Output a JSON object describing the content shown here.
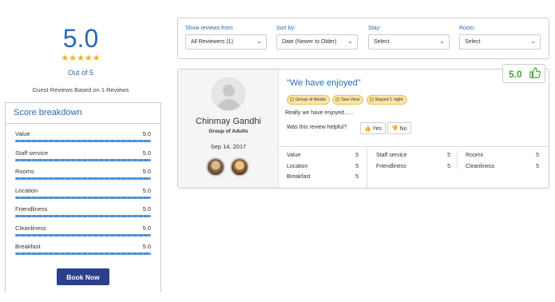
{
  "summary": {
    "score": "5.0",
    "stars": "★★★★★",
    "out_of": "Out of 5",
    "based_on": "Guest Reviews Based on 1 Reviews"
  },
  "breakdown": {
    "title": "Score breakdown",
    "rows": [
      {
        "label": "Value",
        "value": "5.0",
        "fraction": 1.0
      },
      {
        "label": "Staff service",
        "value": "5.0",
        "fraction": 1.0
      },
      {
        "label": "Rooms",
        "value": "5.0",
        "fraction": 1.0
      },
      {
        "label": "Location",
        "value": "5.0",
        "fraction": 1.0
      },
      {
        "label": "Friendliness",
        "value": "5.0",
        "fraction": 1.0
      },
      {
        "label": "Cleanliness",
        "value": "5.0",
        "fraction": 1.0
      },
      {
        "label": "Breakfast",
        "value": "5.0",
        "fraction": 1.0
      }
    ],
    "book_button": "Book Now"
  },
  "filters": {
    "show_from": {
      "label": "Show reviews from:",
      "value": "All Reviewers (1)"
    },
    "sort_by": {
      "label": "Sort by:",
      "value": "Date (Newer to Older)"
    },
    "stay": {
      "label": "Stay:",
      "value": "Select"
    },
    "room": {
      "label": "Room:",
      "value": "Select"
    }
  },
  "review": {
    "name": "Chinmay Gandhi",
    "group": "Group of Adults",
    "date": "Sep 14, 2017",
    "score": "5.0",
    "title": "\"We have enjoyed\"",
    "tags": [
      "Group of Adults",
      "Sea View",
      "Stayed 1 night"
    ],
    "text": "Really we have enjoyed......",
    "helpful_prompt": "Was this review helpful?",
    "yes_label": "Yes",
    "no_label": "No",
    "scores": [
      [
        {
          "label": "Value",
          "value": "5"
        },
        {
          "label": "Location",
          "value": "5"
        },
        {
          "label": "Breakfast",
          "value": "5"
        }
      ],
      [
        {
          "label": "Staff service",
          "value": "5"
        },
        {
          "label": "Friendliness",
          "value": "5"
        }
      ],
      [
        {
          "label": "Rooms",
          "value": "5"
        },
        {
          "label": "Cleanliness",
          "value": "5"
        }
      ]
    ]
  },
  "colors": {
    "accent": "#2a6ab5",
    "button": "#2b3f8c",
    "score_green": "#4aa33b",
    "star": "#f2b01e",
    "tag": "#fbe3a4"
  }
}
